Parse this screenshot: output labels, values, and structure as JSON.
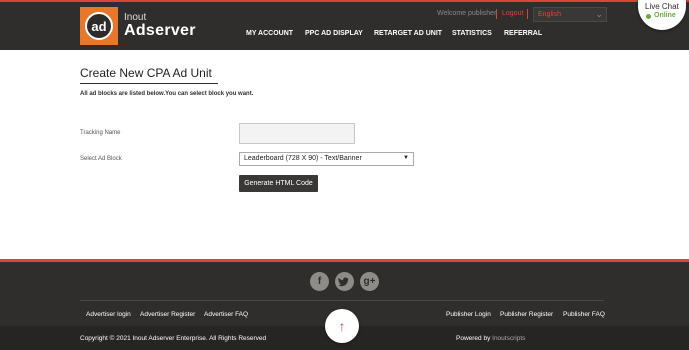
{
  "header": {
    "logo": {
      "mark": "ad",
      "small": "Inout",
      "big": "Adserver"
    },
    "welcome": "Welcome publisher",
    "logout": "Logout",
    "language": {
      "selected": "English"
    },
    "nav": [
      "MY ACCOUNT",
      "PPC AD DISPLAY",
      "RETARGET AD UNIT",
      "STATISTICS",
      "REFERRAL"
    ]
  },
  "live_chat": {
    "title": "Live Chat",
    "status": "Online",
    "status_color": "#6aaa3a"
  },
  "main": {
    "title": "Create New CPA Ad Unit",
    "subtitle": "All ad blocks are listed below.You can select block you want.",
    "tracking_name_label": "Tracking Name",
    "tracking_name_value": "",
    "select_label": "Select Ad Block",
    "select_value": "Leaderboard (728 X 90) - Text/Banner",
    "generate_button": "Generate HTML Code"
  },
  "footer": {
    "social": [
      {
        "icon": "facebook-icon",
        "glyph": "f"
      },
      {
        "icon": "twitter-icon",
        "glyph": "🐦"
      },
      {
        "icon": "google-plus-icon",
        "glyph": "g+"
      }
    ],
    "left_links": [
      "Advertiser login",
      "Advertiser Register",
      "Advertiser FAQ"
    ],
    "right_links": [
      "Publisher Login",
      "Publisher Register",
      "Publisher FAQ"
    ],
    "copyright": "Copyright © 2021 Inout Adserver Enterprise. All Rights Reserved",
    "powered_prefix": "Powered by",
    "powered_by": "Inoutscripts"
  },
  "colors": {
    "accent": "#d9453c",
    "logo": "#e7772b",
    "dark": "#302e2c"
  }
}
